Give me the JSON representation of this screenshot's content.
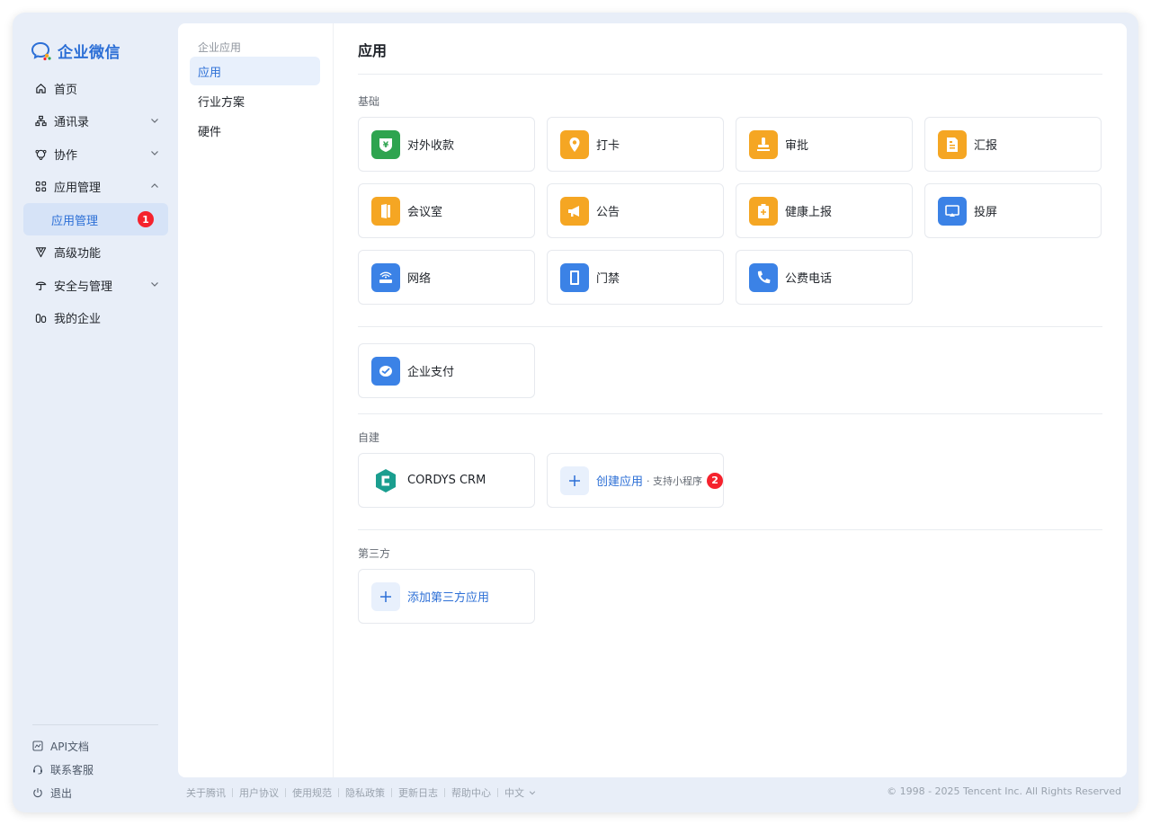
{
  "brand": {
    "name": "企业微信",
    "accent": "#2c6fd6"
  },
  "sidebar": {
    "items": [
      {
        "label": "首页",
        "icon": "home-icon"
      },
      {
        "label": "通讯录",
        "icon": "org-chart-icon",
        "chevron": "down"
      },
      {
        "label": "协作",
        "icon": "collaboration-icon",
        "chevron": "down"
      },
      {
        "label": "应用管理",
        "icon": "apps-grid-icon",
        "chevron": "up"
      },
      {
        "label": "应用管理",
        "sub": true,
        "badge": "1"
      },
      {
        "label": "高级功能",
        "icon": "advanced-icon"
      },
      {
        "label": "安全与管理",
        "icon": "security-icon",
        "chevron": "down"
      },
      {
        "label": "我的企业",
        "icon": "enterprise-icon"
      }
    ],
    "bottom": [
      {
        "label": "API文档",
        "icon": "api-doc-icon"
      },
      {
        "label": "联系客服",
        "icon": "headset-icon"
      },
      {
        "label": "退出",
        "icon": "power-icon"
      }
    ]
  },
  "subnav": {
    "title": "企业应用",
    "items": [
      "应用",
      "行业方案",
      "硬件"
    ]
  },
  "main": {
    "title": "应用",
    "sections": {
      "basic": "基础",
      "custom": "自建",
      "third": "第三方"
    },
    "basic_apps": [
      {
        "label": "对外收款",
        "icon": "payment-shield-icon",
        "color": "#2ea44f"
      },
      {
        "label": "打卡",
        "icon": "location-pin-icon",
        "color": "#f5a623"
      },
      {
        "label": "审批",
        "icon": "stamp-icon",
        "color": "#f5a623"
      },
      {
        "label": "汇报",
        "icon": "report-icon",
        "color": "#f5a623"
      },
      {
        "label": "会议室",
        "icon": "door-icon",
        "color": "#f5a623"
      },
      {
        "label": "公告",
        "icon": "megaphone-icon",
        "color": "#f5a623"
      },
      {
        "label": "健康上报",
        "icon": "health-clipboard-icon",
        "color": "#f5a623"
      },
      {
        "label": "投屏",
        "icon": "screencast-icon",
        "color": "#3b82e6"
      },
      {
        "label": "网络",
        "icon": "router-icon",
        "color": "#3b82e6"
      },
      {
        "label": "门禁",
        "icon": "access-door-icon",
        "color": "#3b82e6"
      },
      {
        "label": "公费电话",
        "icon": "phone-icon",
        "color": "#3b82e6"
      }
    ],
    "pay_app": {
      "label": "企业支付",
      "icon": "wallet-icon",
      "color": "#3b82e6"
    },
    "custom_apps": [
      {
        "label": "CORDYS CRM",
        "icon": "cordys-logo-icon"
      }
    ],
    "create_app": {
      "label": "创建应用",
      "sub": "· 支持小程序",
      "badge": "2"
    },
    "add_third": {
      "label": "添加第三方应用"
    }
  },
  "footer": {
    "links": [
      "关于腾讯",
      "用户协议",
      "使用规范",
      "隐私政策",
      "更新日志",
      "帮助中心",
      "中文"
    ],
    "copyright": "© 1998 - 2025 Tencent Inc. All Rights Reserved"
  }
}
